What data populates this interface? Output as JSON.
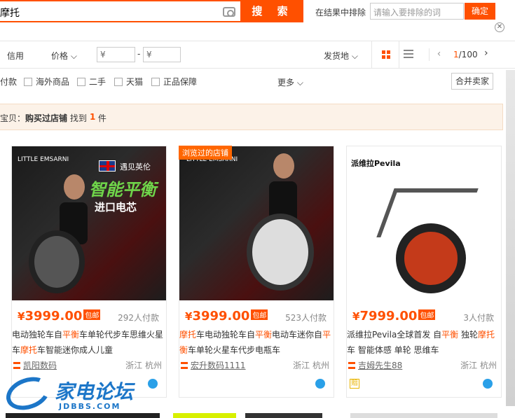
{
  "search": {
    "query": "摩托",
    "button": "搜 索"
  },
  "exclude": {
    "label": "在结果中排除",
    "placeholder": "请输入要排除的词",
    "confirm": "确定"
  },
  "sortbar": {
    "credit": "信用",
    "price": "价格",
    "price_min_placeholder": "¥",
    "price_dash": "-",
    "price_max_placeholder": "¥",
    "ship_from": "发货地",
    "pager_current": "1",
    "pager_total": "/100",
    "prev": "‹",
    "next": "›"
  },
  "filters": {
    "items": [
      "付款",
      "海外商品",
      "二手",
      "天猫",
      "正品保障"
    ],
    "more": "更多",
    "merge": "合并卖家"
  },
  "notice": {
    "prefix": "宝贝：",
    "bold": "购买过店铺",
    "mid": " 找到 ",
    "count": "1",
    "suffix": " 件"
  },
  "products": [
    {
      "img_brand": "LITTLE EMSARNI",
      "img_text1": "遇见英伦",
      "img_text2": "智能平衡",
      "img_text3": "进口电芯",
      "price_symbol": "¥",
      "price": "3999.00",
      "badge": "包邮",
      "sold": "292人付款",
      "title_parts": [
        "电动独轮车自",
        "平衡",
        "车单轮代步车思维火星车",
        "摩托",
        "车智能迷你成人儿童"
      ],
      "shop": "凯阳数码",
      "province": "浙江",
      "city": "杭州"
    },
    {
      "viewed_tag": "浏览过的店铺",
      "img_brand": "LITTLE EMSARNI",
      "price_symbol": "¥",
      "price": "3999.00",
      "badge": "包邮",
      "sold": "523人付款",
      "title_parts": [
        "摩托",
        "车电动独轮车自",
        "平衡",
        "电动车迷你自",
        "平衡",
        "车单轮火星车代步电瓶车"
      ],
      "shop": "宏升数码1111",
      "province": "浙江",
      "city": "杭州"
    },
    {
      "img_brand": "派维拉Pevila",
      "price_symbol": "¥",
      "price": "7999.00",
      "badge": "包邮",
      "sold": "3人付款",
      "title_parts": [
        "派维拉Pevila全球首发 自",
        "平衡",
        " 独轮",
        "摩托",
        "车 智能体感 单轮 思维车"
      ],
      "shop": "吉姆先生88",
      "province": "浙江",
      "city": "杭州"
    }
  ],
  "watermark": {
    "cn": "家电论坛",
    "en": "JDBBS.COM"
  },
  "colors": {
    "accent": "#ff5000",
    "logo_blue": "#1c76c8"
  }
}
